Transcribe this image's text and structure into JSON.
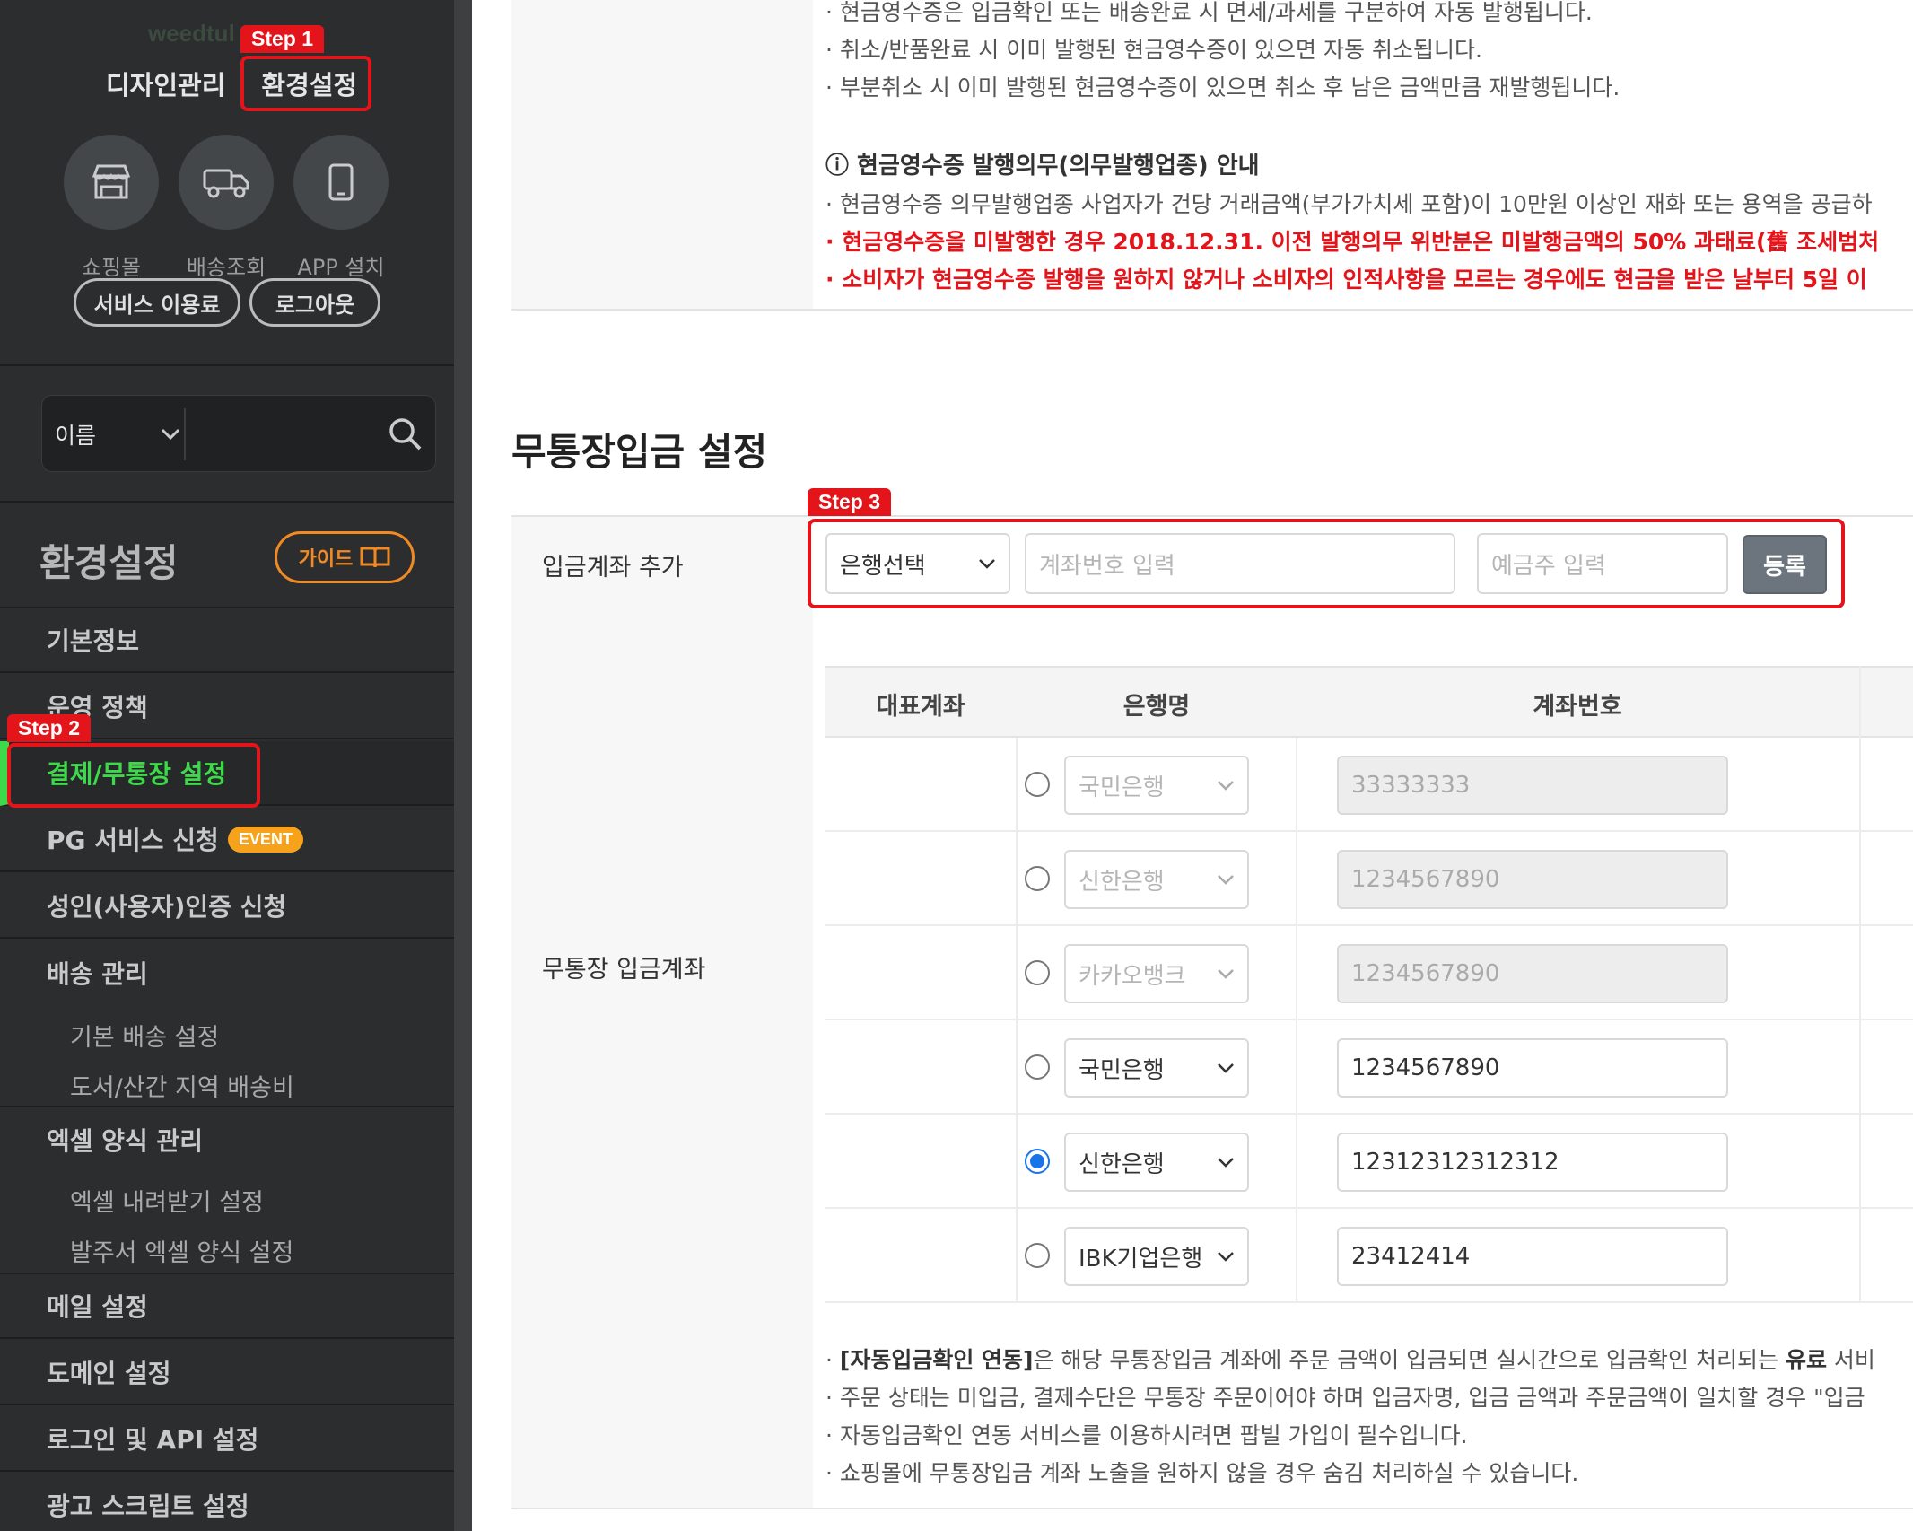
{
  "sidebar": {
    "brand": "weedtul",
    "topnav": [
      "디자인관리",
      "환경설정"
    ],
    "quick": [
      {
        "label": "쇼핑몰",
        "icon": "store-icon"
      },
      {
        "label": "배송조회",
        "icon": "truck-icon"
      },
      {
        "label": "APP 설치",
        "icon": "mobile-icon"
      }
    ],
    "pills": [
      "서비스 이용료",
      "로그아웃"
    ],
    "search": {
      "select": "이름"
    },
    "section_title": "환경설정",
    "guide_label": "가이드",
    "menu": [
      "기본정보",
      "운영 정책",
      "결제/무통장 설정",
      "PG 서비스 신청",
      "성인(사용자)인증 신청",
      "배송 관리",
      "엑셀 양식 관리",
      "메일 설정",
      "도메인 설정",
      "로그인 및 API 설정",
      "광고 스크립트 설정"
    ],
    "event_badge": "EVENT",
    "submenu_delivery": [
      "기본 배송 설정",
      "도서/산간 지역 배송비"
    ],
    "submenu_excel": [
      "엑셀 내려받기 설정",
      "발주서 엑셀 양식 설정"
    ]
  },
  "steps": [
    "Step 1",
    "Step 2",
    "Step 3"
  ],
  "notices": {
    "top": [
      "· 현금영수증은 입금확인 또는 배송완료 시 면세/과세를 구분하여 자동 발행됩니다.",
      "· 취소/반품완료 시 이미 발행된 현금영수증이 있으면 자동 취소됩니다.",
      "· 부분취소 시 이미 발행된 현금영수증이 있으면 취소 후 남은 금액만큼 재발행됩니다."
    ],
    "obligation_head": "ⓘ 현금영수증 발행의무(의무발행업종) 안내",
    "obligation_1": "· 현금영수증 의무발행업종 사업자가 건당 거래금액(부가가치세 포함)이 10만원 이상인 재화 또는 용역을 공급하",
    "obligation_red_1": "· 현금영수증을 미발행한 경우 2018.12.31. 이전 발행의무 위반분은 미발행금액의 50% 과태료(舊 조세범처",
    "obligation_red_2": "· 소비자가 현금영수증 발행을 원하지 않거나 소비자의 인적사항을 모르는 경우에도 현금을 받은 날부터 5일 이"
  },
  "bank_section": {
    "title": "무통장입금 설정",
    "add_label": "입금계좌 추가",
    "bank_select": "은행선택",
    "account_placeholder": "계좌번호 입력",
    "holder_placeholder": "예금주 입력",
    "register_button": "등록",
    "list_label": "무통장 입금계좌",
    "columns": [
      "대표계좌",
      "은행명",
      "계좌번호"
    ],
    "rows": [
      {
        "bank": "국민은행",
        "account": "33333333",
        "disabled": true,
        "selected": false
      },
      {
        "bank": "신한은행",
        "account": "1234567890",
        "disabled": true,
        "selected": false
      },
      {
        "bank": "카카오뱅크",
        "account": "1234567890",
        "disabled": true,
        "selected": false
      },
      {
        "bank": "국민은행",
        "account": "1234567890",
        "disabled": false,
        "selected": false
      },
      {
        "bank": "신한은행",
        "account": "12312312312312",
        "disabled": false,
        "selected": true
      },
      {
        "bank": "IBK기업은행",
        "account": "23412414",
        "disabled": false,
        "selected": false
      }
    ],
    "bullets": {
      "b1_pre": "· ",
      "b1_bold": "[자동입금확인 연동]",
      "b1_mid": "은 해당 무통장입금 계좌에 주문 금액이 입금되면 실시간으로 입금확인 처리되는 ",
      "b1_bold2": "유료",
      "b1_post": " 서비",
      "b2": "· 주문 상태는 미입금, 결제수단은 무통장 주문이어야 하며 입금자명, 입금 금액과 주문금액이 일치할 경우 \"입금",
      "b3": "· 자동입금확인 연동 서비스를 이용하시려면 팝빌 가입이 필수입니다.",
      "b4": "· 쇼핑몰에 무통장입금 계좌 노출을 원하지 않을 경우 숨김 처리하실 수 있습니다."
    }
  }
}
